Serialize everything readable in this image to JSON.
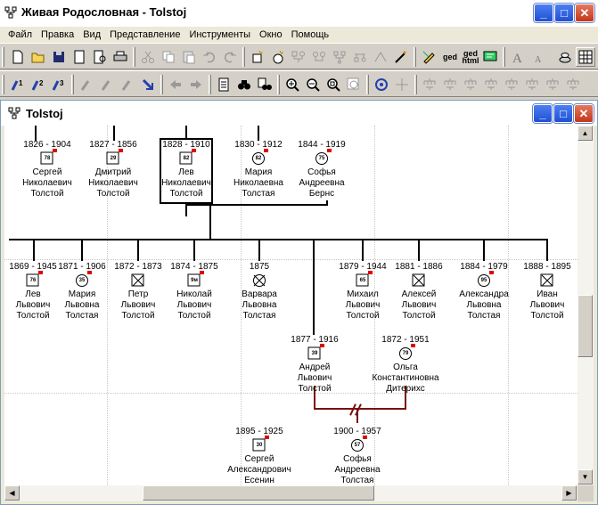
{
  "window": {
    "title": "Живая Родословная - Tolstoj"
  },
  "menu": [
    "Файл",
    "Правка",
    "Вид",
    "Представление",
    "Инструменты",
    "Окно",
    "Помощь"
  ],
  "toolbar": {
    "ged_label": "ged",
    "ged_html_top": "ged",
    "ged_html_bottom": "html"
  },
  "document": {
    "title": "Tolstoj"
  },
  "tree": {
    "parents": [
      {
        "years": "1826 - 1904",
        "name1": "Сергей",
        "name2": "Николаевич",
        "name3": "Толстой",
        "age": "78",
        "sex": "m"
      },
      {
        "years": "1827 - 1856",
        "name1": "Дмитрий",
        "name2": "Николаевич",
        "name3": "Толстой",
        "age": "29",
        "sex": "m"
      },
      {
        "years": "1828 - 1910",
        "name1": "Лев",
        "name2": "Николаевич",
        "name3": "Толстой",
        "age": "82",
        "sex": "m"
      },
      {
        "years": "1830 - 1912",
        "name1": "Мария",
        "name2": "Николаевна",
        "name3": "Толстая",
        "age": "82",
        "sex": "f"
      },
      {
        "years": "1844 - 1919",
        "name1": "Софья",
        "name2": "Андреевна",
        "name3": "Бернс",
        "age": "75",
        "sex": "f"
      }
    ],
    "children": [
      {
        "years": "1869 - 1945",
        "name1": "Лев",
        "name2": "Львович",
        "name3": "Толстой",
        "age": "76",
        "sex": "m"
      },
      {
        "years": "1871 - 1906",
        "name1": "Мария",
        "name2": "Львовна",
        "name3": "Толстая",
        "age": "35",
        "sex": "f"
      },
      {
        "years": "1872 - 1873",
        "name1": "Петр",
        "name2": "Львович",
        "name3": "Толстой",
        "age": "",
        "sex": "md"
      },
      {
        "years": "1874 - 1875",
        "name1": "Николай",
        "name2": "Львович",
        "name3": "Толстой",
        "age": "9м",
        "sex": "m"
      },
      {
        "years": "1875",
        "name1": "Варвара",
        "name2": "Львовна",
        "name3": "Толстая",
        "age": "",
        "sex": "fd"
      },
      {
        "years": "1879 - 1944",
        "name1": "Михаил",
        "name2": "Львович",
        "name3": "Толстой",
        "age": "65",
        "sex": "m"
      },
      {
        "years": "1881 - 1886",
        "name1": "Алексей",
        "name2": "Львович",
        "name3": "Толстой",
        "age": "",
        "sex": "md"
      },
      {
        "years": "1884 - 1979",
        "name1": "Александра",
        "name2": "Львовна",
        "name3": "Толстая",
        "age": "95",
        "sex": "f"
      },
      {
        "years": "1888 - 1895",
        "name1": "Иван",
        "name2": "Львович",
        "name3": "Толстой",
        "age": "",
        "sex": "md"
      }
    ],
    "couple": [
      {
        "years": "1877 - 1916",
        "name1": "Андрей",
        "name2": "Львович",
        "name3": "Толстой",
        "age": "39",
        "sex": "m"
      },
      {
        "years": "1872 - 1951",
        "name1": "Ольга",
        "name2": "Константиновна",
        "name3": "Дитерихс",
        "age": "79",
        "sex": "f"
      }
    ],
    "grandchildren": [
      {
        "years": "1895 - 1925",
        "name1": "Сергей",
        "name2": "Александрович",
        "name3": "Есенин",
        "age": "30",
        "sex": "m"
      },
      {
        "years": "1900 - 1957",
        "name1": "Софья",
        "name2": "Андреевна",
        "name3": "Толстая",
        "age": "57",
        "sex": "f"
      }
    ]
  }
}
